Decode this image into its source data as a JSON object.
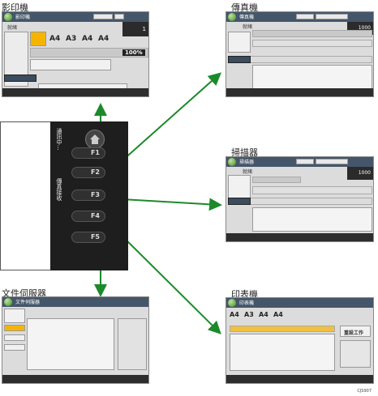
{
  "labels": {
    "copier": "影印機",
    "fax": "傳真機",
    "scanner": "掃描器",
    "document_server": "文件伺服器",
    "printer": "印表機"
  },
  "panel": {
    "keys": [
      "F1",
      "F2",
      "F3",
      "F4",
      "F5"
    ],
    "side_labels": [
      "通訊中...",
      "傳真接收"
    ]
  },
  "copier_screen": {
    "title": "影印機",
    "status": "就緒",
    "paper_sizes": [
      "A4",
      "A3",
      "A4",
      "A4"
    ],
    "ratio": "100%",
    "counter": "1"
  },
  "fax_screen": {
    "title": "傳真機",
    "status": "就緒",
    "counter": "1000"
  },
  "scanner_screen": {
    "title": "掃描器",
    "status": "就緒",
    "counter": "1000"
  },
  "docserver_screen": {
    "title": "文件伺服器"
  },
  "printer_screen": {
    "title": "印表機",
    "paper_sizes": [
      "A4",
      "A3",
      "A4",
      "A4"
    ],
    "reset_button": "重設工作"
  },
  "image_code": "CJS907",
  "colors": {
    "arrow": "#1c8a2a",
    "titlebar": "#45566a",
    "panel": "#1e1e1e",
    "key": "#303030"
  }
}
